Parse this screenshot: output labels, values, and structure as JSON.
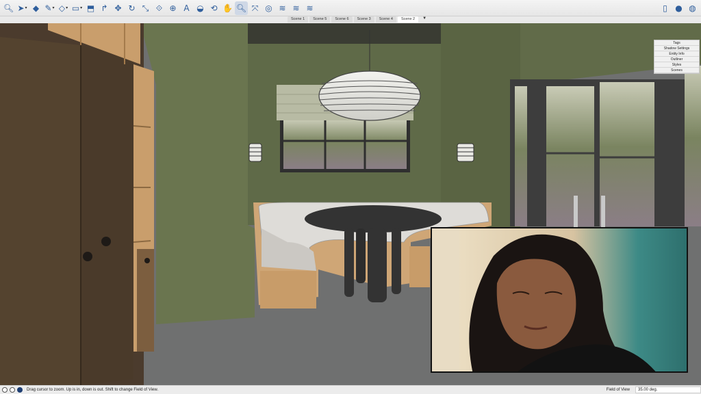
{
  "toolbar": {
    "tools": [
      {
        "icon": "search-icon",
        "glyph": "🔍︎",
        "caret": false
      },
      {
        "icon": "select-arrow-icon",
        "glyph": "➤",
        "caret": true
      },
      {
        "icon": "eraser-icon",
        "glyph": "◆",
        "caret": false
      },
      {
        "icon": "pencil-icon",
        "glyph": "✎",
        "caret": true
      },
      {
        "icon": "shape-icon",
        "glyph": "◇",
        "caret": true
      },
      {
        "icon": "rectangle-icon",
        "glyph": "▭",
        "caret": true
      },
      {
        "icon": "push-pull-icon",
        "glyph": "⬒",
        "caret": false
      },
      {
        "icon": "follow-me-icon",
        "glyph": "↱",
        "caret": false
      },
      {
        "icon": "move-icon",
        "glyph": "✥",
        "caret": false
      },
      {
        "icon": "rotate-icon",
        "glyph": "↻",
        "caret": false
      },
      {
        "icon": "scale-icon",
        "glyph": "⤡",
        "caret": false
      },
      {
        "icon": "offset-icon",
        "glyph": "⟐",
        "caret": false
      },
      {
        "icon": "tape-measure-icon",
        "glyph": "⊕",
        "caret": false
      },
      {
        "icon": "text-icon",
        "glyph": "A",
        "caret": false
      },
      {
        "icon": "paint-bucket-icon",
        "glyph": "◒",
        "caret": false
      },
      {
        "icon": "orbit-icon",
        "glyph": "⟲",
        "caret": false
      },
      {
        "icon": "pan-icon",
        "glyph": "✋",
        "caret": false
      },
      {
        "icon": "zoom-icon",
        "glyph": "🔍︎",
        "caret": false,
        "active": true
      },
      {
        "icon": "zoom-extents-icon",
        "glyph": "⤧",
        "caret": false
      },
      {
        "icon": "warehouse-icon",
        "glyph": "◎",
        "caret": false
      },
      {
        "icon": "extension-icon",
        "glyph": "≋",
        "caret": false
      },
      {
        "icon": "layout-icon",
        "glyph": "≋",
        "caret": false
      },
      {
        "icon": "style-builder-icon",
        "glyph": "≋",
        "caret": false
      }
    ],
    "right": [
      {
        "icon": "document-icon",
        "glyph": "▯"
      },
      {
        "icon": "user-icon",
        "glyph": "●"
      },
      {
        "icon": "account-icon",
        "glyph": "◍"
      }
    ]
  },
  "scenes": {
    "tabs": [
      "Scene 1",
      "Scene 5",
      "Scene 6",
      "Scene 3",
      "Scene 4",
      "Scene 2"
    ],
    "active": "Scene 2",
    "menu_glyph": "▼"
  },
  "tray": {
    "items": [
      "Tags",
      "Shadow Settings",
      "Entity Info",
      "Outliner",
      "Styles",
      "Scenes"
    ]
  },
  "status": {
    "message": "Drag cursor to zoom.  Up is in, down is out. Shift to change Field of View.",
    "measure_label": "Field of View",
    "measure_value": "35.00 deg."
  },
  "colors": {
    "accent": "#2f5e9c",
    "wall_green": "#5f6a48",
    "floor_gray": "#6f7070",
    "wood": "#cda574",
    "cabinet_brown": "#4a3a2c"
  }
}
